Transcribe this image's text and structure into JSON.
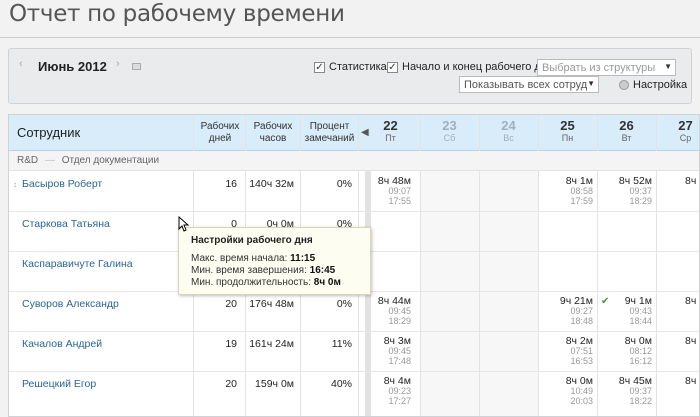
{
  "page": {
    "title": "Отчет по рабочему времени"
  },
  "filters": {
    "month": "Июнь 2012",
    "prev_icon": "chevron-left-icon",
    "next_icon": "chevron-right-icon",
    "calendar_icon": "calendar-icon",
    "statistics_label": "Статистика",
    "statistics_checked": true,
    "workday_label": "Начало и конец рабочего дня",
    "workday_checked": true,
    "structure_select": "Выбрать из структуры",
    "employees_select": "Показывать всех сотруд",
    "settings_label": "Настройка"
  },
  "table": {
    "header": {
      "employee": "Сотрудник",
      "work_days_1": "Рабочих",
      "work_days_2": "дней",
      "work_hours_1": "Рабочих",
      "work_hours_2": "часов",
      "percent_1": "Процент",
      "percent_2": "замечаний"
    },
    "days": [
      {
        "num": "22",
        "dow": "Пт",
        "weekend": false
      },
      {
        "num": "23",
        "dow": "Сб",
        "weekend": true
      },
      {
        "num": "24",
        "dow": "Вс",
        "weekend": true
      },
      {
        "num": "25",
        "dow": "Пн",
        "weekend": false
      },
      {
        "num": "26",
        "dow": "Вт",
        "weekend": false
      },
      {
        "num": "27",
        "dow": "Ср",
        "weekend": false
      }
    ],
    "department": {
      "company": "R&D",
      "separator": "—",
      "name": "Отдел документации"
    },
    "rows": [
      {
        "name": "Басыров Роберт",
        "days": "16",
        "hours": "140ч 32м",
        "percent": "0%",
        "d22": [
          "8ч 48м",
          "09:07",
          "17:55"
        ],
        "d25": [
          "8ч 1м",
          "08:58",
          "17:59"
        ],
        "d26": [
          "8ч 52м",
          "09:37",
          "18:29"
        ],
        "d27": [
          "8ч",
          "",
          ""
        ]
      },
      {
        "name": "Старкова Татьяна",
        "days": "0",
        "hours": "0ч 0м",
        "percent": "0%"
      },
      {
        "name": "Каспаравичуте Галина",
        "days": "",
        "hours": "",
        "percent": ""
      },
      {
        "name": "Суворов Александр",
        "days": "20",
        "hours": "176ч 48м",
        "percent": "0%",
        "d22": [
          "8ч 44м",
          "09:45",
          "18:29"
        ],
        "d25": [
          "9ч 21м",
          "09:27",
          "18:48"
        ],
        "d26": [
          "9ч 1м",
          "09:43",
          "18:44"
        ],
        "d27": [
          "8ч",
          "",
          ""
        ]
      },
      {
        "name": "Качалов Андрей",
        "days": "19",
        "hours": "161ч 24м",
        "percent": "11%",
        "d22": [
          "8ч 3м",
          "09:45",
          "17:48"
        ],
        "d25": [
          "8ч 2м",
          "07:51",
          "16:53"
        ],
        "d26": [
          "8ч 0м",
          "08:12",
          "16:12"
        ],
        "d27": [
          "8ч",
          "",
          ""
        ]
      },
      {
        "name": "Решецкий Егор",
        "days": "20",
        "hours": "159ч 0м",
        "percent": "40%",
        "d22": [
          "8ч 4м",
          "09:23",
          "17:27"
        ],
        "d25": [
          "8ч 0м",
          "10:49",
          "20:03"
        ],
        "d26": [
          "8ч 45м",
          "09:37",
          "18:22"
        ],
        "d27": [
          "8ч",
          "",
          ""
        ]
      }
    ]
  },
  "tooltip": {
    "title": "Настройки рабочего дня",
    "max_start_label": "Макс. время начала:",
    "max_start_value": "11:15",
    "min_end_label": "Мин. время завершения:",
    "min_end_value": "16:45",
    "min_duration_label": "Мин. продолжительность:",
    "min_duration_value": "8ч 0м"
  }
}
